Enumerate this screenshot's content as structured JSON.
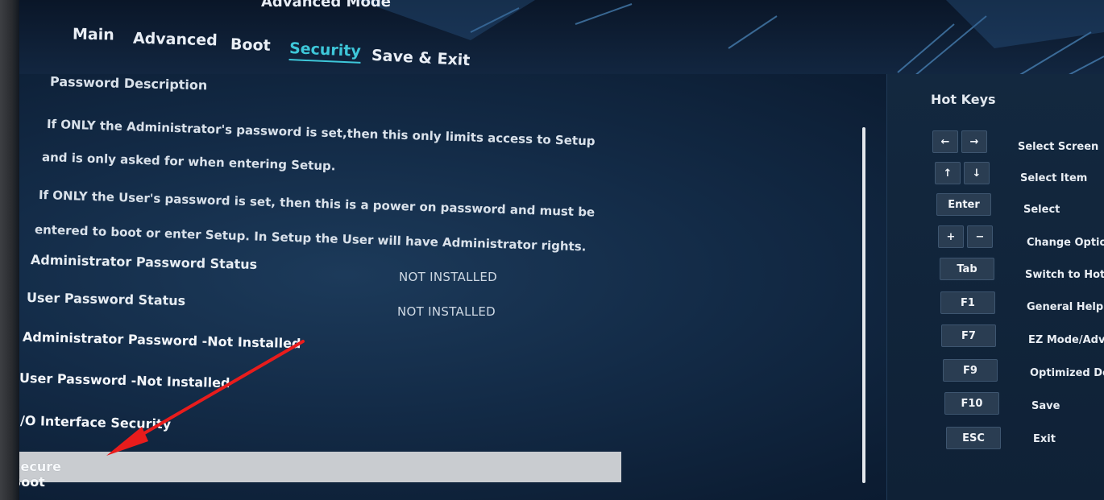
{
  "header": {
    "mode_title": "Advanced Mode"
  },
  "tabs": [
    {
      "label": "Main"
    },
    {
      "label": "Advanced"
    },
    {
      "label": "Boot"
    },
    {
      "label": "Security",
      "active": true
    },
    {
      "label": "Save & Exit"
    }
  ],
  "description": {
    "heading": "Password Description",
    "lines": [
      "If ONLY the Administrator's password is set,then this only limits access to Setup",
      "and is only asked for when entering Setup.",
      "If ONLY the User's password is set, then this is a power on password and must be",
      "entered to boot or enter Setup. In Setup the User will have Administrator rights."
    ]
  },
  "status_rows": [
    {
      "label": "Administrator Password Status",
      "value": "NOT INSTALLED"
    },
    {
      "label": "User Password Status",
      "value": "NOT INSTALLED"
    }
  ],
  "menu_items": [
    {
      "label": "Administrator Password -Not Installed"
    },
    {
      "label": "User Password -Not Installed"
    },
    {
      "label": "I/O Interface Security"
    }
  ],
  "selected_item": {
    "label": "Secure Boot"
  },
  "hotkeys": {
    "title": "Hot Keys",
    "items": [
      {
        "keys": [
          "←",
          "→"
        ],
        "desc": "Select Screen"
      },
      {
        "keys": [
          "↑",
          "↓"
        ],
        "desc": "Select Item"
      },
      {
        "keys": [
          "Enter"
        ],
        "desc": "Select"
      },
      {
        "keys": [
          "+",
          "−"
        ],
        "desc": "Change Option"
      },
      {
        "keys": [
          "Tab"
        ],
        "desc": "Switch to Hotkeys"
      },
      {
        "keys": [
          "F1"
        ],
        "desc": "General Help"
      },
      {
        "keys": [
          "F7"
        ],
        "desc": "EZ Mode/Advanced Mode"
      },
      {
        "keys": [
          "F9"
        ],
        "desc": "Optimized Defaults"
      },
      {
        "keys": [
          "F10"
        ],
        "desc": "Save"
      },
      {
        "keys": [
          "ESC"
        ],
        "desc": "Exit"
      }
    ]
  },
  "colors": {
    "accent": "#3ec7d9",
    "annotation_arrow": "#e81c1c",
    "selection_bar": "#c9ccd0"
  }
}
